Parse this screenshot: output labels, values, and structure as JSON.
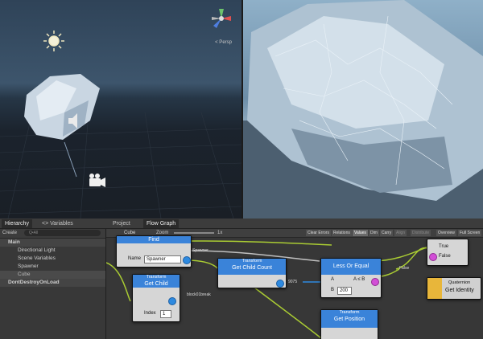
{
  "scene_view": {
    "label": "< Persp"
  },
  "tabs": [
    {
      "label": "Hierarchy",
      "active": true
    },
    {
      "label": "<> Variables",
      "active": false
    },
    {
      "label": "Project",
      "active": false
    },
    {
      "label": "Flow Graph",
      "active": true
    }
  ],
  "hierarchy": {
    "create_label": "Create",
    "search_placeholder": "Q•All",
    "items": [
      {
        "label": "Main"
      },
      {
        "label": "Directional Light"
      },
      {
        "label": "Scene Variables"
      },
      {
        "label": "Spawner"
      },
      {
        "label": "Cube"
      },
      {
        "label": "DontDestroyOnLoad"
      }
    ]
  },
  "graph_toolbar": {
    "object_label": "Cube",
    "zoom_label": "Zoom",
    "zoom_value": "1x",
    "buttons": [
      "Clear Errors",
      "Relations",
      "Values",
      "Dim",
      "Carry",
      "Align",
      "Distribute",
      "Overview",
      "Full Screen"
    ]
  },
  "nodes": {
    "find": {
      "title": "Find",
      "name_label": "Name",
      "name_value": "Spawner",
      "output": "Spawner"
    },
    "get_child": {
      "title": "Transform",
      "subtitle": "Get Child",
      "index_label": "Index",
      "index_value": "1",
      "output": "block01break"
    },
    "get_child_count": {
      "title": "Transform",
      "subtitle": "Get Child Count",
      "output": "9075"
    },
    "less_or_equal": {
      "title": "Less Or Equal",
      "a_label": "A",
      "a_rel": "A ≤ B",
      "b_label": "B",
      "b_value": "200",
      "result": "False"
    },
    "branch": {
      "true_label": "True",
      "false_label": "False"
    },
    "identity": {
      "title": "Quaternion",
      "subtitle": "Get Identity"
    },
    "get_position": {
      "title": "Transform",
      "subtitle": "Get Position"
    }
  }
}
